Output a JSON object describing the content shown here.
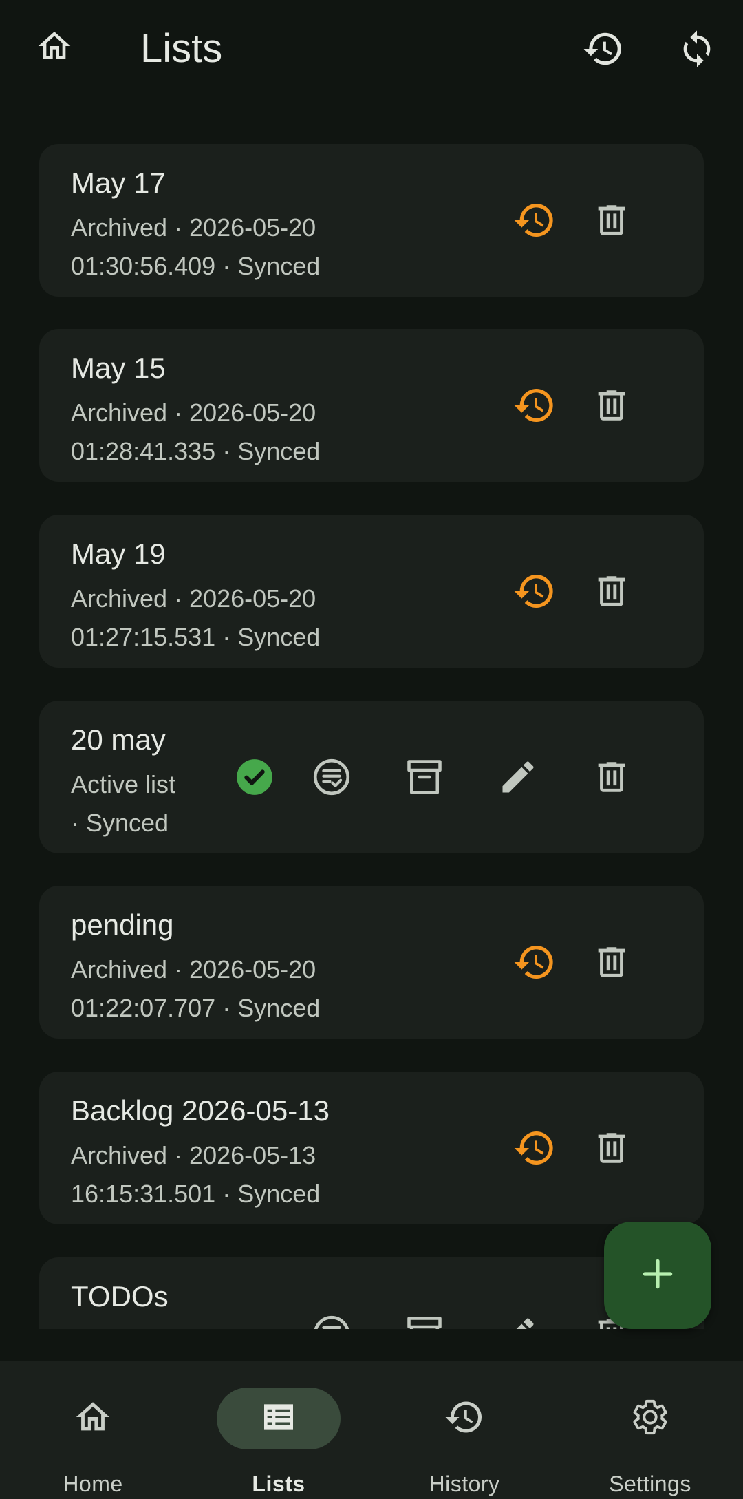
{
  "header": {
    "title": "Lists",
    "home_icon": "home-icon",
    "history_icon": "history-icon",
    "sync_icon": "sync-icon"
  },
  "lists": [
    {
      "name": "May 17",
      "status_line1": "Archived · 2026-05-20",
      "status_line2": "01:30:56.409 · Synced",
      "state": "archived"
    },
    {
      "name": "May 15",
      "status_line1": "Archived · 2026-05-20",
      "status_line2": "01:28:41.335 · Synced",
      "state": "archived"
    },
    {
      "name": "May 19",
      "status_line1": "Archived · 2026-05-20",
      "status_line2": "01:27:15.531 · Synced",
      "state": "archived"
    },
    {
      "name": "20 may",
      "status_line1": "Active list",
      "status_line2": "· Synced",
      "state": "active"
    },
    {
      "name": "pending",
      "status_line1": "Archived · 2026-05-20",
      "status_line2": "01:22:07.707 · Synced",
      "state": "archived"
    },
    {
      "name": "Backlog 2026-05-13",
      "status_line1": "Archived · 2026-05-13",
      "status_line2": "16:15:31.501 · Synced",
      "state": "archived"
    },
    {
      "name": "TODOs",
      "status_line1": "",
      "status_line2": "",
      "state": "inactive"
    }
  ],
  "fab": {
    "icon": "plus-icon"
  },
  "bottom_nav": [
    {
      "label": "Home",
      "icon": "home-icon",
      "active": false
    },
    {
      "label": "Lists",
      "icon": "list-icon",
      "active": true
    },
    {
      "label": "History",
      "icon": "history-icon",
      "active": false
    },
    {
      "label": "Settings",
      "icon": "gear-icon",
      "active": false
    }
  ],
  "colors": {
    "background": "#101511",
    "card": "#1b201c",
    "restore_accent": "#f5951f",
    "active_check": "#46a84b",
    "fab": "#245328",
    "fab_icon": "#b7f0b0",
    "nav_active_pill": "#3a4b3c"
  }
}
